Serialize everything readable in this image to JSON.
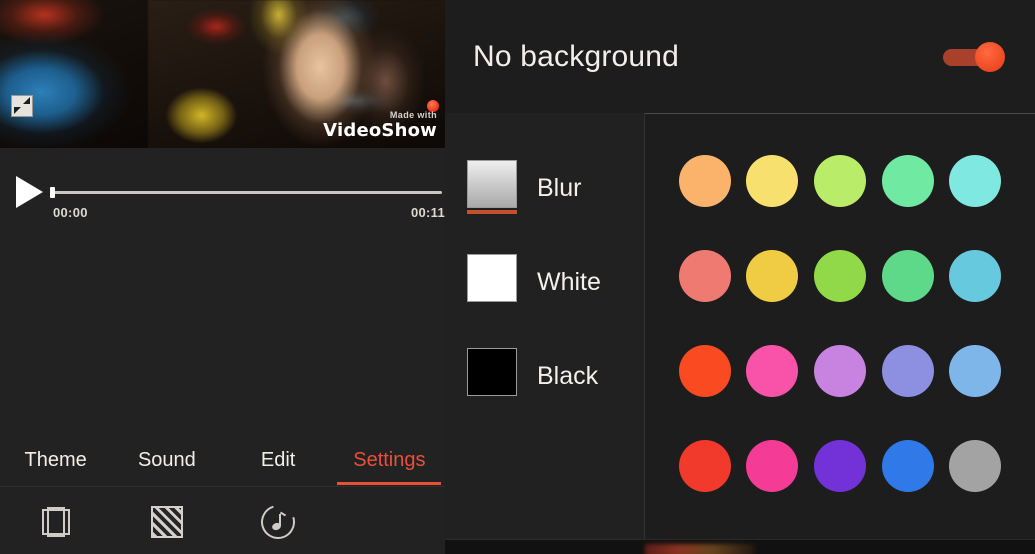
{
  "app": {
    "name": "VideoShow",
    "accent_color": "#e8503a",
    "background_color": "#222222",
    "panel_color": "#1d1d1d"
  },
  "preview": {
    "watermark_line1": "Made with",
    "watermark_line2": "VideoShow",
    "resize_handle_icon": "resize-handle-icon"
  },
  "player": {
    "play_icon": "play-icon",
    "current_time": "00:00",
    "total_time": "00:11",
    "progress_percent": 0
  },
  "tabs": [
    {
      "label": "Theme",
      "active": false
    },
    {
      "label": "Sound",
      "active": false
    },
    {
      "label": "Edit",
      "active": false
    },
    {
      "label": "Settings",
      "active": true
    }
  ],
  "toolbar_icons": [
    {
      "name": "frame-crop-icon"
    },
    {
      "name": "hatched-pattern-icon"
    },
    {
      "name": "music-note-icon"
    }
  ],
  "settings_panel": {
    "header": {
      "title": "No background",
      "toggle_on": true,
      "toggle_color": "#f04d26"
    },
    "modes": [
      {
        "label": "Blur",
        "selected": true,
        "chip": "gradient-gray"
      },
      {
        "label": "White",
        "selected": false,
        "chip": "#ffffff"
      },
      {
        "label": "Black",
        "selected": false,
        "chip": "#000000"
      }
    ],
    "selected_mode": "Blur",
    "color_rows": [
      [
        "#fbb36b",
        "#f7e06e",
        "#b9ec69",
        "#70e9a2",
        "#7fe8e0"
      ],
      [
        "#ef7a72",
        "#f0cb44",
        "#92d94a",
        "#5ed98a",
        "#66c9dd"
      ],
      [
        "#fa4a22",
        "#f953a9",
        "#c882e0",
        "#8d8fe0",
        "#7fb6ea"
      ],
      [
        "#f23a2c",
        "#f43b96",
        "#7331d8",
        "#2f7ae8",
        "#a3a3a3"
      ]
    ]
  }
}
